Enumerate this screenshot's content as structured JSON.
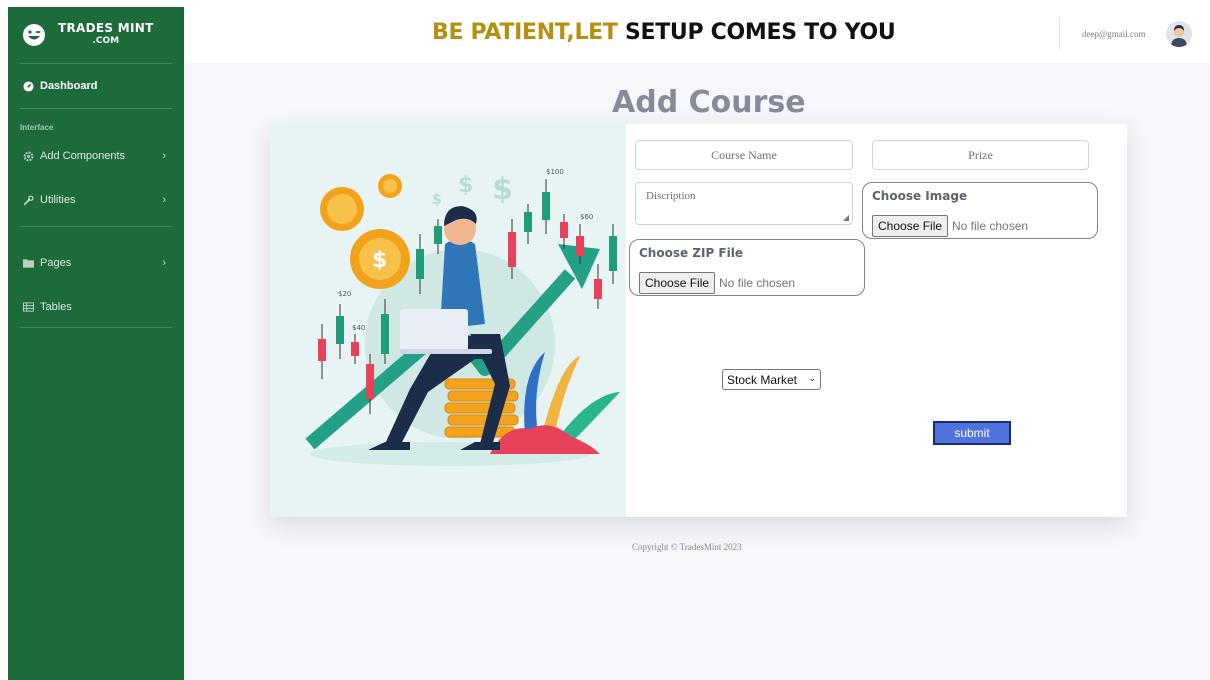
{
  "brand": {
    "line1": "TRADES MINT",
    "line2": ".COM"
  },
  "sidebar": {
    "dashboard": "Dashboard",
    "section": "Interface",
    "items": [
      {
        "label": "Add Components",
        "icon": "gear-icon"
      },
      {
        "label": "Utilities",
        "icon": "wrench-icon"
      },
      {
        "label": "Pages",
        "icon": "folder-icon"
      },
      {
        "label": "Tables",
        "icon": "table-icon"
      }
    ]
  },
  "header": {
    "headline_part1": "BE PATIENT,LET ",
    "headline_part2": "SETUP COMES TO YOU",
    "user_email": "deep@gmail.com"
  },
  "page": {
    "title": "Add Course"
  },
  "form": {
    "course_name": "Course Name",
    "prize": "Prize",
    "description": "Discription",
    "choose_image_label": "Choose Image",
    "choose_zip_label": "Choose ZIP File",
    "file_button": "Choose File",
    "no_file": "No file chosen",
    "category": "Stock Market",
    "submit": "submit"
  },
  "illustration": {
    "price_labels": [
      "$100",
      "$60",
      "$20",
      "$40"
    ],
    "coin_symbol": "$"
  },
  "footer": {
    "copyright": "Copyright © TradesMint 2023"
  },
  "colors": {
    "sidebar": "#1d6b3a",
    "accent": "#4e73df",
    "headline_gold": "#b5900f"
  }
}
